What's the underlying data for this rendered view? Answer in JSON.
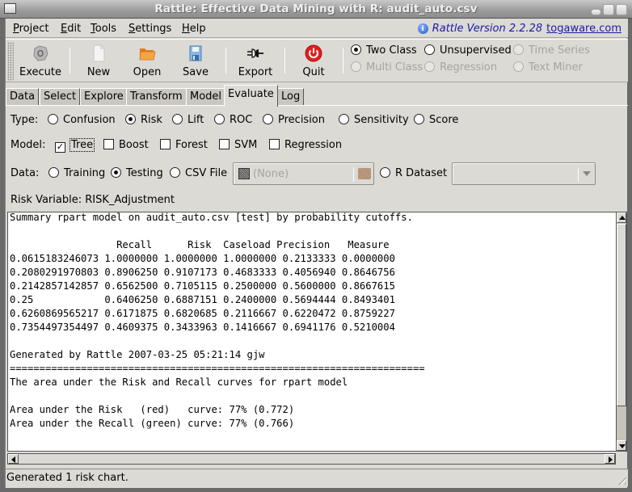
{
  "window": {
    "title": "Rattle: Effective Data Mining with R: audit_auto.csv"
  },
  "menubar": {
    "items": [
      {
        "label": "Project",
        "mnemonic": "P",
        "rest": "roject"
      },
      {
        "label": "Edit",
        "mnemonic": "E",
        "rest": "dit"
      },
      {
        "label": "Tools",
        "mnemonic": "T",
        "rest": "ools"
      },
      {
        "label": "Settings",
        "mnemonic": "S",
        "rest": "ettings"
      },
      {
        "label": "Help",
        "mnemonic": "H",
        "rest": "elp"
      }
    ],
    "version_text": "Rattle Version 2.2.28",
    "version_link": "togaware.com"
  },
  "toolbar": {
    "buttons": [
      {
        "label": "Execute",
        "icon": "execute-icon"
      },
      {
        "label": "New",
        "icon": "new-document-icon"
      },
      {
        "label": "Open",
        "icon": "folder-icon"
      },
      {
        "label": "Save",
        "icon": "floppy-disk-icon"
      },
      {
        "label": "Export",
        "icon": "plug-icon"
      },
      {
        "label": "Quit",
        "icon": "power-icon"
      }
    ],
    "mode_options": [
      {
        "label": "Two Class",
        "checked": true,
        "enabled": true
      },
      {
        "label": "Unsupervised",
        "checked": false,
        "enabled": true
      },
      {
        "label": "Time Series",
        "checked": false,
        "enabled": false
      },
      {
        "label": "Multi Class",
        "checked": false,
        "enabled": false
      },
      {
        "label": "Regression",
        "checked": false,
        "enabled": false
      },
      {
        "label": "Text Miner",
        "checked": false,
        "enabled": false
      }
    ]
  },
  "tabs": [
    {
      "label": "Data",
      "active": false
    },
    {
      "label": "Select",
      "active": false
    },
    {
      "label": "Explore",
      "active": false
    },
    {
      "label": "Transform",
      "active": false
    },
    {
      "label": "Model",
      "active": false
    },
    {
      "label": "Evaluate",
      "active": true
    },
    {
      "label": "Log",
      "active": false
    }
  ],
  "evaluate": {
    "type_label": "Type:",
    "type_options": [
      {
        "label": "Confusion",
        "checked": false
      },
      {
        "label": "Risk",
        "checked": true
      },
      {
        "label": "Lift",
        "checked": false
      },
      {
        "label": "ROC",
        "checked": false
      },
      {
        "label": "Precision",
        "checked": false
      },
      {
        "label": "Sensitivity",
        "checked": false
      },
      {
        "label": "Score",
        "checked": false
      }
    ],
    "model_label": "Model:",
    "model_options": [
      {
        "label": "Tree",
        "checked": true
      },
      {
        "label": "Boost",
        "checked": false
      },
      {
        "label": "Forest",
        "checked": false
      },
      {
        "label": "SVM",
        "checked": false
      },
      {
        "label": "Regression",
        "checked": false
      }
    ],
    "data_label": "Data:",
    "data_options": [
      {
        "label": "Training",
        "checked": false
      },
      {
        "label": "Testing",
        "checked": true
      },
      {
        "label": "CSV File",
        "checked": false
      },
      {
        "label": "R Dataset",
        "checked": false
      }
    ],
    "csv_file_value": "(None)",
    "r_dataset_value": "",
    "risk_variable_text": "Risk Variable: RISK_Adjustment"
  },
  "output": {
    "lines": [
      "Summary rpart model on audit_auto.csv [test] by probability cutoffs.",
      "",
      "                  Recall      Risk  Caseload Precision   Measure",
      "0.0615183246073 1.0000000 1.0000000 1.0000000 0.2133333 0.0000000",
      "0.2080291970803 0.8906250 0.9107173 0.4683333 0.4056940 0.8646756",
      "0.2142857142857 0.6562500 0.7105115 0.2500000 0.5600000 0.8667615",
      "0.25            0.6406250 0.6887151 0.2400000 0.5694444 0.8493401",
      "0.6260869565217 0.6171875 0.6820685 0.2116667 0.6220472 0.8759227",
      "0.7354497354497 0.4609375 0.3433963 0.1416667 0.6941176 0.5210004",
      "",
      "Generated by Rattle 2007-03-25 05:21:14 gjw",
      "======================================================================",
      "The area under the Risk and Recall curves for rpart model",
      "",
      "Area under the Risk   (red)   curve: 77% (0.772)",
      "Area under the Recall (green) curve: 77% (0.766)"
    ]
  },
  "status": {
    "text": "Generated 1 risk chart."
  },
  "colors": {
    "background": "#dcdad5",
    "link": "#1a1aa8",
    "quit_red": "#e02020",
    "open_orange": "#f29a2e"
  }
}
